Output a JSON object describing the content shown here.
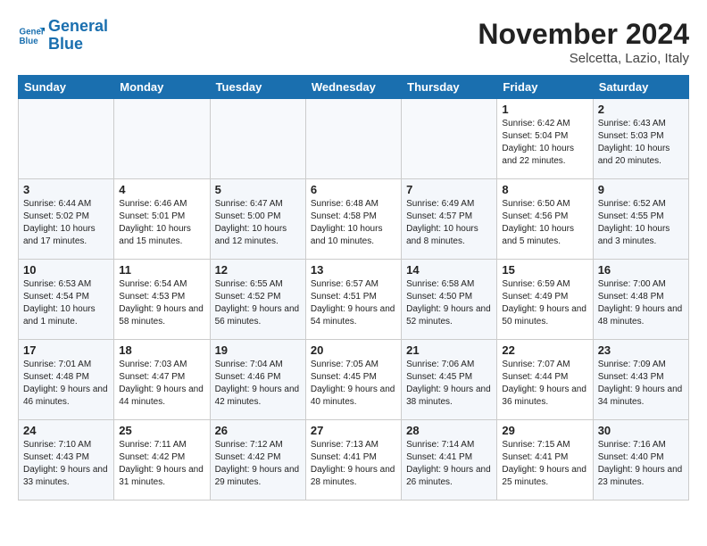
{
  "header": {
    "logo_line1": "General",
    "logo_line2": "Blue",
    "month_title": "November 2024",
    "location": "Selcetta, Lazio, Italy"
  },
  "days_of_week": [
    "Sunday",
    "Monday",
    "Tuesday",
    "Wednesday",
    "Thursday",
    "Friday",
    "Saturday"
  ],
  "weeks": [
    [
      {
        "day": "",
        "info": ""
      },
      {
        "day": "",
        "info": ""
      },
      {
        "day": "",
        "info": ""
      },
      {
        "day": "",
        "info": ""
      },
      {
        "day": "",
        "info": ""
      },
      {
        "day": "1",
        "info": "Sunrise: 6:42 AM\nSunset: 5:04 PM\nDaylight: 10 hours and 22 minutes."
      },
      {
        "day": "2",
        "info": "Sunrise: 6:43 AM\nSunset: 5:03 PM\nDaylight: 10 hours and 20 minutes."
      }
    ],
    [
      {
        "day": "3",
        "info": "Sunrise: 6:44 AM\nSunset: 5:02 PM\nDaylight: 10 hours and 17 minutes."
      },
      {
        "day": "4",
        "info": "Sunrise: 6:46 AM\nSunset: 5:01 PM\nDaylight: 10 hours and 15 minutes."
      },
      {
        "day": "5",
        "info": "Sunrise: 6:47 AM\nSunset: 5:00 PM\nDaylight: 10 hours and 12 minutes."
      },
      {
        "day": "6",
        "info": "Sunrise: 6:48 AM\nSunset: 4:58 PM\nDaylight: 10 hours and 10 minutes."
      },
      {
        "day": "7",
        "info": "Sunrise: 6:49 AM\nSunset: 4:57 PM\nDaylight: 10 hours and 8 minutes."
      },
      {
        "day": "8",
        "info": "Sunrise: 6:50 AM\nSunset: 4:56 PM\nDaylight: 10 hours and 5 minutes."
      },
      {
        "day": "9",
        "info": "Sunrise: 6:52 AM\nSunset: 4:55 PM\nDaylight: 10 hours and 3 minutes."
      }
    ],
    [
      {
        "day": "10",
        "info": "Sunrise: 6:53 AM\nSunset: 4:54 PM\nDaylight: 10 hours and 1 minute."
      },
      {
        "day": "11",
        "info": "Sunrise: 6:54 AM\nSunset: 4:53 PM\nDaylight: 9 hours and 58 minutes."
      },
      {
        "day": "12",
        "info": "Sunrise: 6:55 AM\nSunset: 4:52 PM\nDaylight: 9 hours and 56 minutes."
      },
      {
        "day": "13",
        "info": "Sunrise: 6:57 AM\nSunset: 4:51 PM\nDaylight: 9 hours and 54 minutes."
      },
      {
        "day": "14",
        "info": "Sunrise: 6:58 AM\nSunset: 4:50 PM\nDaylight: 9 hours and 52 minutes."
      },
      {
        "day": "15",
        "info": "Sunrise: 6:59 AM\nSunset: 4:49 PM\nDaylight: 9 hours and 50 minutes."
      },
      {
        "day": "16",
        "info": "Sunrise: 7:00 AM\nSunset: 4:48 PM\nDaylight: 9 hours and 48 minutes."
      }
    ],
    [
      {
        "day": "17",
        "info": "Sunrise: 7:01 AM\nSunset: 4:48 PM\nDaylight: 9 hours and 46 minutes."
      },
      {
        "day": "18",
        "info": "Sunrise: 7:03 AM\nSunset: 4:47 PM\nDaylight: 9 hours and 44 minutes."
      },
      {
        "day": "19",
        "info": "Sunrise: 7:04 AM\nSunset: 4:46 PM\nDaylight: 9 hours and 42 minutes."
      },
      {
        "day": "20",
        "info": "Sunrise: 7:05 AM\nSunset: 4:45 PM\nDaylight: 9 hours and 40 minutes."
      },
      {
        "day": "21",
        "info": "Sunrise: 7:06 AM\nSunset: 4:45 PM\nDaylight: 9 hours and 38 minutes."
      },
      {
        "day": "22",
        "info": "Sunrise: 7:07 AM\nSunset: 4:44 PM\nDaylight: 9 hours and 36 minutes."
      },
      {
        "day": "23",
        "info": "Sunrise: 7:09 AM\nSunset: 4:43 PM\nDaylight: 9 hours and 34 minutes."
      }
    ],
    [
      {
        "day": "24",
        "info": "Sunrise: 7:10 AM\nSunset: 4:43 PM\nDaylight: 9 hours and 33 minutes."
      },
      {
        "day": "25",
        "info": "Sunrise: 7:11 AM\nSunset: 4:42 PM\nDaylight: 9 hours and 31 minutes."
      },
      {
        "day": "26",
        "info": "Sunrise: 7:12 AM\nSunset: 4:42 PM\nDaylight: 9 hours and 29 minutes."
      },
      {
        "day": "27",
        "info": "Sunrise: 7:13 AM\nSunset: 4:41 PM\nDaylight: 9 hours and 28 minutes."
      },
      {
        "day": "28",
        "info": "Sunrise: 7:14 AM\nSunset: 4:41 PM\nDaylight: 9 hours and 26 minutes."
      },
      {
        "day": "29",
        "info": "Sunrise: 7:15 AM\nSunset: 4:41 PM\nDaylight: 9 hours and 25 minutes."
      },
      {
        "day": "30",
        "info": "Sunrise: 7:16 AM\nSunset: 4:40 PM\nDaylight: 9 hours and 23 minutes."
      }
    ]
  ]
}
